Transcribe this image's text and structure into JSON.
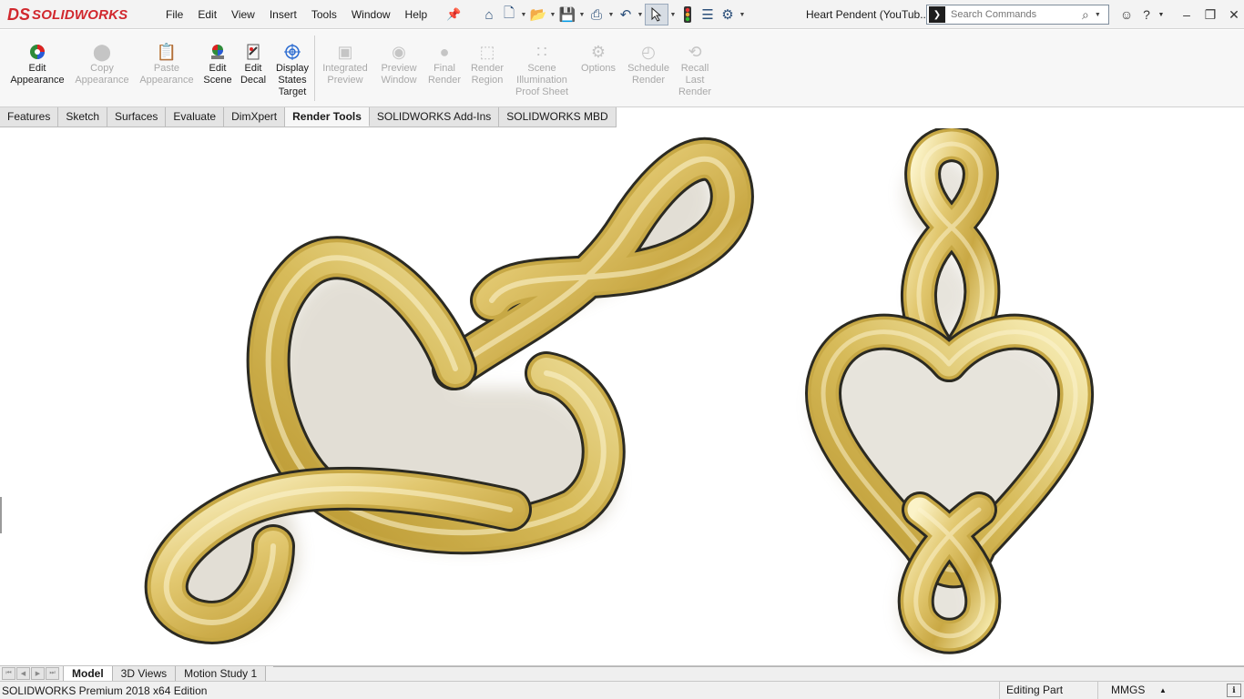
{
  "app": {
    "logo_text": "SOLIDWORKS",
    "logo_mark": "DS",
    "document_title": "Heart Pendent (YouTub..."
  },
  "menu": {
    "items": [
      "File",
      "Edit",
      "View",
      "Insert",
      "Tools",
      "Window",
      "Help"
    ]
  },
  "search": {
    "placeholder": "Search Commands"
  },
  "ribbon": {
    "buttons": [
      {
        "label": "Edit\nAppearance",
        "icon": "edit-appearance-icon",
        "enabled": true
      },
      {
        "label": "Copy\nAppearance",
        "icon": "copy-appearance-icon",
        "enabled": false
      },
      {
        "label": "Paste\nAppearance",
        "icon": "paste-appearance-icon",
        "enabled": false
      },
      {
        "label": "Edit\nScene",
        "icon": "edit-scene-icon",
        "enabled": true
      },
      {
        "label": "Edit\nDecal",
        "icon": "edit-decal-icon",
        "enabled": true
      },
      {
        "label": "Display\nStates\nTarget",
        "icon": "display-states-target-icon",
        "enabled": true
      },
      {
        "label": "Integrated\nPreview",
        "icon": "integrated-preview-icon",
        "enabled": false
      },
      {
        "label": "Preview\nWindow",
        "icon": "preview-window-icon",
        "enabled": false
      },
      {
        "label": "Final\nRender",
        "icon": "final-render-icon",
        "enabled": false
      },
      {
        "label": "Render\nRegion",
        "icon": "render-region-icon",
        "enabled": false
      },
      {
        "label": "Scene\nIllumination\nProof Sheet",
        "icon": "scene-illumination-icon",
        "enabled": false
      },
      {
        "label": "Options",
        "icon": "options-icon",
        "enabled": false
      },
      {
        "label": "Schedule\nRender",
        "icon": "schedule-render-icon",
        "enabled": false
      },
      {
        "label": "Recall\nLast\nRender",
        "icon": "recall-last-render-icon",
        "enabled": false
      }
    ]
  },
  "command_tabs": {
    "items": [
      "Features",
      "Sketch",
      "Surfaces",
      "Evaluate",
      "DimXpert",
      "Render Tools",
      "SOLIDWORKS Add-Ins",
      "SOLIDWORKS MBD"
    ],
    "active": "Render Tools"
  },
  "model_tabs": {
    "items": [
      "Model",
      "3D Views",
      "Motion Study 1"
    ],
    "active": "Model"
  },
  "status": {
    "edition": "SOLIDWORKS Premium 2018 x64 Edition",
    "mode": "Editing Part",
    "units": "MMGS"
  },
  "colors": {
    "brand_red": "#d1282e",
    "gold_light": "#f6ecb4",
    "gold_mid": "#d8bd5c",
    "gold_dark": "#8f7224",
    "outline": "#2b2a22"
  }
}
